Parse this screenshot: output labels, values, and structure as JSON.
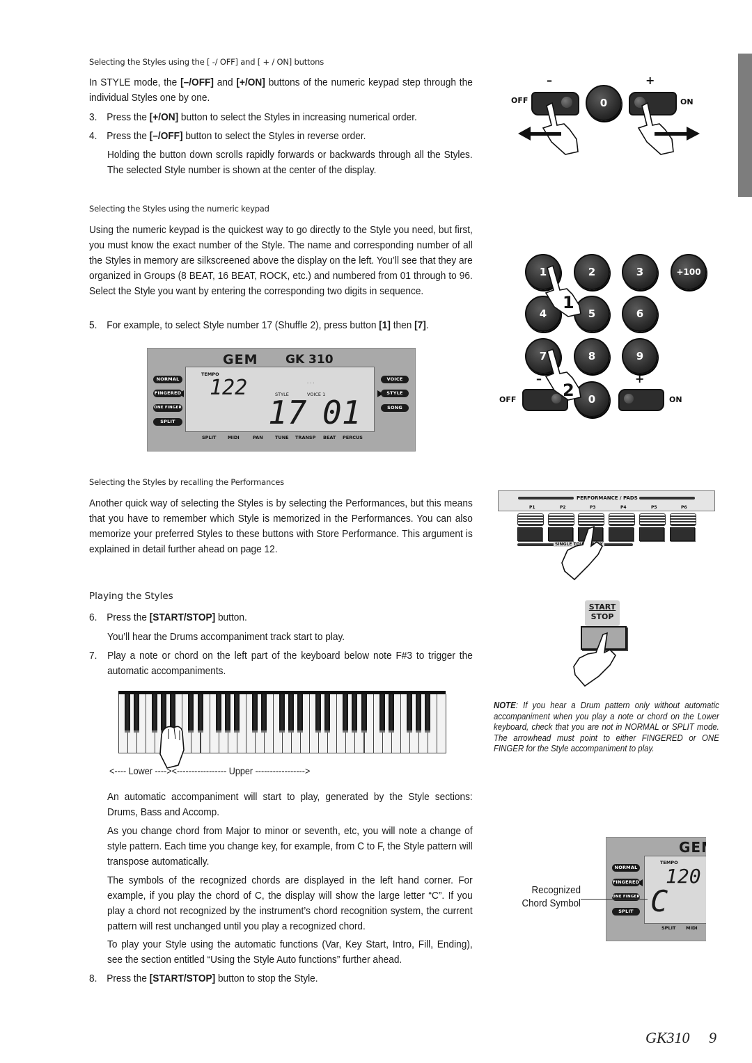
{
  "sections": {
    "s1_heading": "Selecting the Styles using the [ -/ OFF]  and [ + / ON]  buttons",
    "s1_intro_a": "In STYLE mode, the ",
    "s1_intro_b1": "[–/OFF]",
    "s1_intro_c": " and ",
    "s1_intro_b2": "[+/ON]",
    "s1_intro_d": " buttons of the numeric keypad step through the individual Styles one by one.",
    "step3_num": "3.",
    "step3_a": "Press the ",
    "step3_b": "[+/ON]",
    "step3_c": " button to select the Styles in increasing numerical order.",
    "step4_num": "4.",
    "step4_a": "Press the  ",
    "step4_b": "[–/OFF]",
    "step4_c": " button to select the Styles in reverse order.",
    "step4_note": "Holding the button down scrolls rapidly forwards or backwards through all the Styles.  The selected Style number is shown at the center of the display.",
    "s2_heading": "Selecting the Styles using the numeric keypad",
    "s2_body": "Using the numeric keypad is the quickest way to go directly to the Style you need, but first, you must know the exact number of the Style.  The name and corresponding number of all the Styles in memory are silkscreened above the display on the left.  You’ll see that they are organized in Groups (8 BEAT, 16 BEAT, ROCK, etc.) and numbered from 01 through to 96.  Select the Style you want by entering the corresponding two digits in sequence.",
    "step5_num": "5.",
    "step5_a": "For example, to select Style number 17 (Shuffle 2), press button ",
    "step5_b1": "[1]",
    "step5_c": " then ",
    "step5_b2": "[7]",
    "step5_d": ".",
    "s3_heading": "Selecting the Styles by recalling the Performances",
    "s3_body": "Another quick way of selecting the Styles is by selecting the Performances, but this means that you have to remember which Style is memorized in the Performances. You can also memorize your preferred Styles to these buttons with Store Performance.  This argument is explained in detail further ahead on page 12.",
    "s4_heading": "Playing the Styles",
    "step6_num": "6.",
    "step6_a": "Press the ",
    "step6_b": "[START/STOP]",
    "step6_c": " button.",
    "step6_note": "You’ll hear the Drums accompaniment track start to play.",
    "step7_num": "7.",
    "step7_text": "Play a note or chord on the left part of the keyboard below note F#3 to trigger the automatic accompaniments.",
    "keyboard_caption": "<---- Lower ----><----------------- Upper ----------------->",
    "para_auto": "An automatic accompaniment will start to play, generated by the Style sections: Drums, Bass and Accomp.",
    "para_chord": "As you change chord from Major to minor or seventh, etc, you will note a change of style pattern.  Each time you change key, for example, from C to F, the Style pattern will transpose automatically.",
    "para_symbols": "The symbols of the recognized chords are displayed in the left hand corner.  For example, if you play the chord of C, the display will show the large letter “C”.  If you play a chord not recognized by the instrument’s chord recognition system, the current pattern will rest unchanged until you play a recognized chord.",
    "para_auto_funcs": "To play your Style using the automatic functions (Var, Key Start, Intro, Fill, Ending), see the section entitled “Using the Style Auto functions”  further ahead.",
    "step8_num": "8.",
    "step8_a": "Press the ",
    "step8_b": "[START/STOP]",
    "step8_c": " button to stop the Style."
  },
  "note": {
    "label": "NOTE",
    "text": ": If you hear a Drum pattern only without automatic accompaniment when you play a note or chord on the Lower keyboard, check that you are not in NORMAL or SPLIT mode.  The arrowhead must point to either FINGERED or ONE FINGER for the Style accompaniment to play."
  },
  "figure_offon": {
    "minus": "–",
    "plus": "+",
    "off": "OFF",
    "on": "ON",
    "zero": "0"
  },
  "figure_keypad": {
    "keys": [
      "1",
      "2",
      "3",
      "+100",
      "4",
      "5",
      "6",
      "7",
      "8",
      "9",
      "0"
    ],
    "minus": "–",
    "plus": "+",
    "off": "OFF",
    "on": "ON",
    "step1": "1",
    "step2": "2"
  },
  "display_main": {
    "brand": "GEM",
    "model": "GK 310",
    "tempo_label": "TEMPO",
    "tempo_value": "122",
    "style_label": "STYLE",
    "voice_label": "VOICE 1",
    "dots": ". . .",
    "style_number": "17",
    "voice_number": "01",
    "left_buttons": [
      "NORMAL",
      "FINGERED",
      "ONE FINGER",
      "SPLIT"
    ],
    "right_buttons": [
      "VOICE",
      "STYLE",
      "SONG"
    ],
    "bottom_labels": [
      "SPLIT",
      "MIDI",
      "PAN",
      "TUNE",
      "TRANSP",
      "BEAT",
      "PERCUS"
    ]
  },
  "figure_performance": {
    "title": "PERFORMANCE / PADS",
    "pads": [
      "P1",
      "P2",
      "P3",
      "P4",
      "P5",
      "P6"
    ],
    "single_touch": "SINGLE TOUCH PLAY"
  },
  "figure_startstop": {
    "line1": "START",
    "line2": "STOP"
  },
  "display_chord": {
    "brand": "GEM",
    "tempo_label": "TEMPO",
    "tempo_value": "120",
    "chord": "C",
    "left_buttons": [
      "NORMAL",
      "FINGERED",
      "ONE FINGER",
      "SPLIT"
    ],
    "bottom_labels": [
      "SPLIT",
      "MIDI"
    ],
    "callout_line1": "Recognized",
    "callout_line2": "Chord Symbol"
  },
  "footer": {
    "model": "GK310",
    "page": "9"
  },
  "colors": {
    "panel_gray": "#a9a9a9",
    "lcd_gray": "#d9d9d9",
    "side_tab": "#7d7d7d"
  }
}
